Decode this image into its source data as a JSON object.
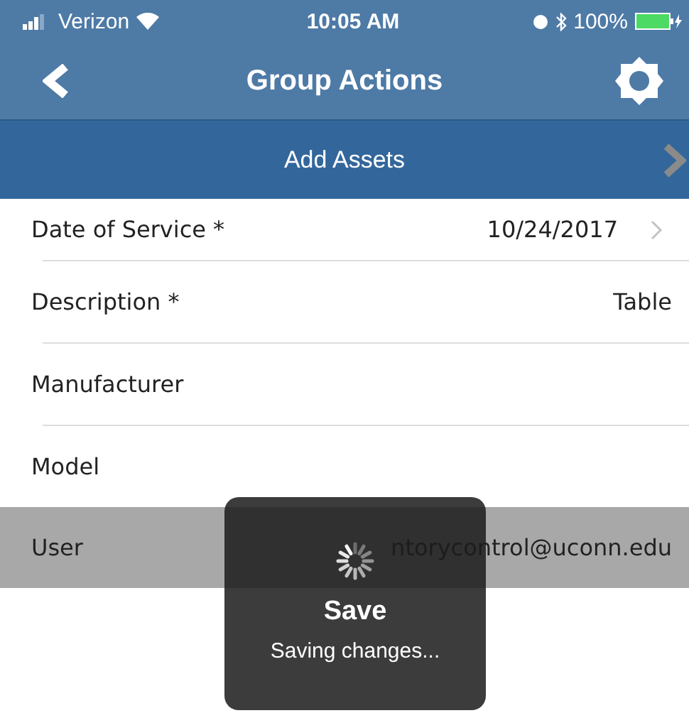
{
  "status_bar": {
    "carrier": "Verizon",
    "time": "10:05 AM",
    "battery": "100%"
  },
  "nav_bar": {
    "title": "Group Actions"
  },
  "action_bar": {
    "label": "Add Assets"
  },
  "fields": [
    {
      "label": "Date of Service *",
      "value": "10/24/2017",
      "has_chevron": true,
      "highlighted": false
    },
    {
      "label": "Description *",
      "value": "Table",
      "has_chevron": false,
      "highlighted": false
    },
    {
      "label": "Manufacturer",
      "has_chevron": false,
      "highlighted": false
    },
    {
      "label": "Model",
      "has_chevron": false,
      "highlighted": false
    },
    {
      "label": "User",
      "value": "ntorycontrol@uconn.edu",
      "has_chevron": false,
      "highlighted": true
    }
  ],
  "progress_hud": {
    "title": "Save",
    "message": "Saving changes..."
  }
}
